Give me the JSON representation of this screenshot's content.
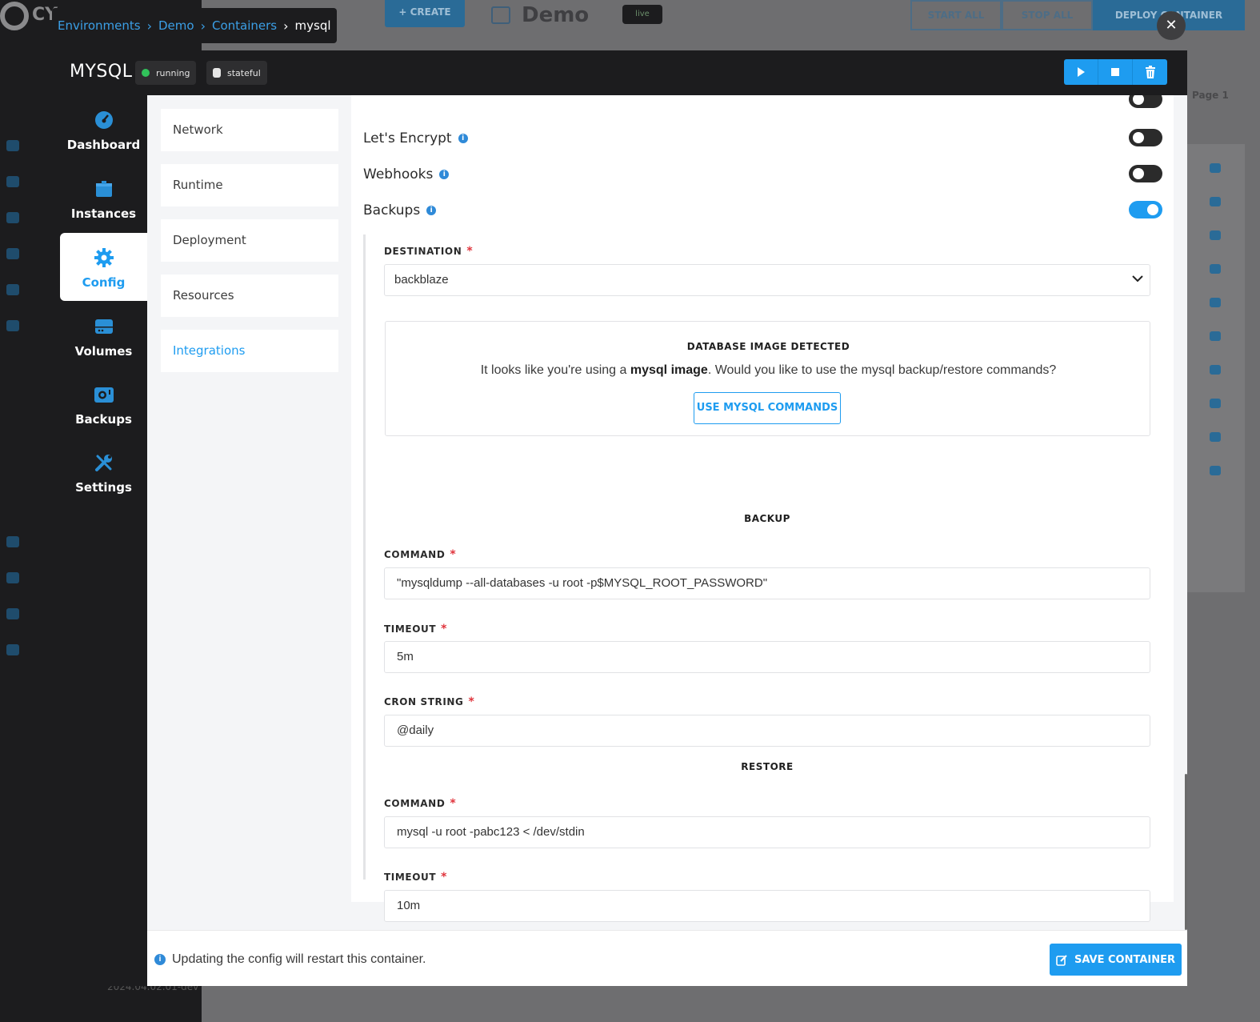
{
  "breadcrumb": {
    "items": [
      "Environments",
      "Demo",
      "Containers"
    ],
    "current": "mysql"
  },
  "background": {
    "logo_text": "CY",
    "create_label": "+ CREATE",
    "demo_title": "Demo",
    "live_badge": "live",
    "start_all": "START ALL",
    "stop_all": "STOP ALL",
    "deploy": "DEPLOY CONTAINER",
    "page": "Page 1",
    "footer": "2024.04.02.01-dev"
  },
  "modal": {
    "title": "MYSQL",
    "status_badge": "running",
    "type_badge": "stateful",
    "close_symbol": "✕"
  },
  "nav": [
    {
      "label": "Dashboard",
      "icon": "gauge-icon"
    },
    {
      "label": "Instances",
      "icon": "box-icon"
    },
    {
      "label": "Config",
      "icon": "gear-icon"
    },
    {
      "label": "Volumes",
      "icon": "drive-icon"
    },
    {
      "label": "Backups",
      "icon": "camera-icon"
    },
    {
      "label": "Settings",
      "icon": "tools-icon"
    }
  ],
  "subnav": [
    {
      "label": "Network"
    },
    {
      "label": "Runtime"
    },
    {
      "label": "Deployment"
    },
    {
      "label": "Resources"
    },
    {
      "label": "Integrations"
    }
  ],
  "integrations": {
    "lets_encrypt": {
      "label": "Let's Encrypt",
      "enabled": false
    },
    "webhooks": {
      "label": "Webhooks",
      "enabled": false
    },
    "backups": {
      "label": "Backups",
      "enabled": true
    }
  },
  "backups": {
    "destination_label": "DESTINATION",
    "destination_value": "backblaze",
    "detect_title": "DATABASE IMAGE DETECTED",
    "detect_text_before": "It looks like you're using a ",
    "detect_text_bold": "mysql image",
    "detect_text_after": ". Would you like to use the mysql backup/restore commands?",
    "use_commands_label": "USE MYSQL COMMANDS",
    "backup_heading": "BACKUP",
    "backup_command_label": "COMMAND",
    "backup_command_value": "\"mysqldump --all-databases -u root -p$MYSQL_ROOT_PASSWORD\"",
    "backup_timeout_label": "TIMEOUT",
    "backup_timeout_value": "5m",
    "cron_label": "CRON STRING",
    "cron_value": "@daily",
    "restore_heading": "RESTORE",
    "restore_command_label": "COMMAND",
    "restore_command_value": "mysql -u root -pabc123 < /dev/stdin",
    "restore_timeout_label": "TIMEOUT",
    "restore_timeout_value": "10m",
    "required_mark": "*"
  },
  "footer": {
    "info_text": "Updating the config will restart this container.",
    "save_label": "SAVE CONTAINER"
  },
  "colors": {
    "accent": "#1e9cf0",
    "running": "#31c25a",
    "required": "#e0343c"
  }
}
